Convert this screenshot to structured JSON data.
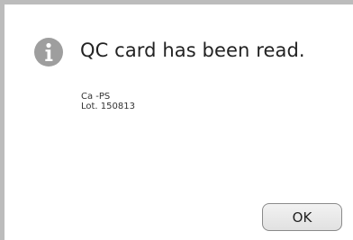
{
  "dialog": {
    "icon": "info-icon",
    "title": "QC card has been read.",
    "details": [
      "Ca -PS",
      "Lot. 150813"
    ],
    "ok_label": "OK"
  },
  "colors": {
    "frame": "#bcbcbc",
    "icon_bg": "#9e9e9e",
    "text": "#222222",
    "button_bg": "#e9e9e9",
    "button_border": "#8a8a8a"
  }
}
